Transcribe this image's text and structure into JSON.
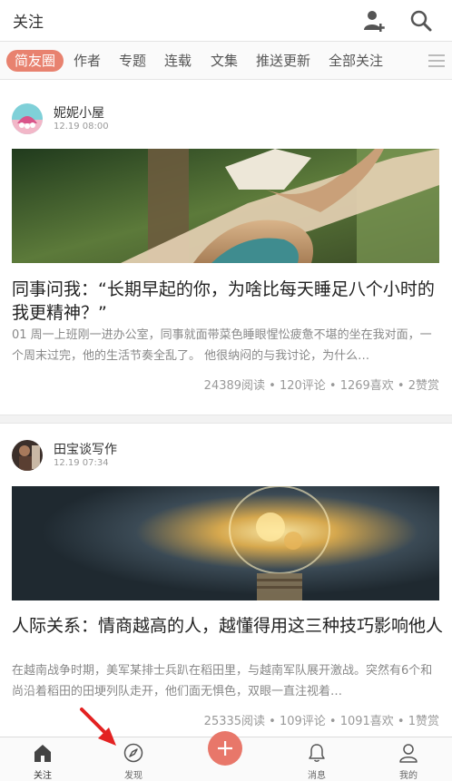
{
  "header": {
    "title": "关注"
  },
  "tabs": [
    {
      "label": "简友圈",
      "active": true
    },
    {
      "label": "作者"
    },
    {
      "label": "专题"
    },
    {
      "label": "连载"
    },
    {
      "label": "文集"
    },
    {
      "label": "推送更新"
    },
    {
      "label": "全部关注"
    }
  ],
  "feed": [
    {
      "author": "妮妮小屋",
      "time": "12.19 08:00",
      "title": "同事问我：“长期早起的你，为啥比每天睡足八个小时的我更精神？”",
      "excerpt": "01 周一上班刚一进办公室，同事就面带菜色睡眼惺忪疲惫不堪的坐在我对面，一个周末过完，他的生活节奏全乱了。 他很纳闷的与我讨论，为什么…",
      "stats": "24389阅读 • 120评论 • 1269喜欢 • 2赞赏"
    },
    {
      "author": "田宝谈写作",
      "time": "12.19 07:34",
      "title": "人际关系：情商越高的人，越懂得用这三种技巧影响他人",
      "excerpt": "在越南战争时期，美军某排士兵趴在稻田里，与越南军队展开激战。突然有6个和尚沿着稻田的田埂列队走开，他们面无惧色，双眼一直注视着…",
      "stats": "25335阅读 • 109评论 • 1091喜欢 • 1赞赏"
    }
  ],
  "bottom_nav": [
    {
      "label": "关注",
      "icon": "home-icon",
      "active": true
    },
    {
      "label": "发现",
      "icon": "compass-icon"
    },
    {
      "label": "",
      "icon": "plus-icon"
    },
    {
      "label": "消息",
      "icon": "bell-icon"
    },
    {
      "label": "我的",
      "icon": "person-icon"
    }
  ],
  "colors": {
    "accent": "#e8826f",
    "annotation_arrow": "#e32222"
  }
}
